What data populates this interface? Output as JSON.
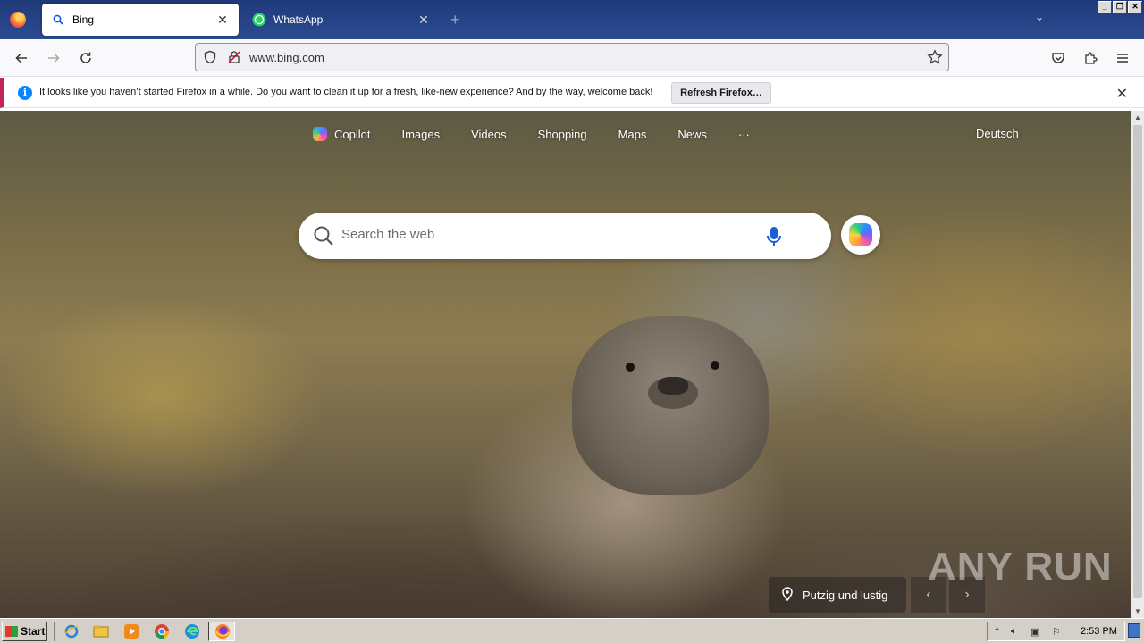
{
  "browser": {
    "tabs": [
      {
        "title": "Bing",
        "active": true,
        "icon": "search-icon"
      },
      {
        "title": "WhatsApp",
        "active": false,
        "icon": "whatsapp-icon"
      }
    ],
    "new_tab_glyph": "+",
    "url": "www.bing.com"
  },
  "notification": {
    "text": "It looks like you haven’t started Firefox in a while. Do you want to clean it up for a fresh, like-new experience? And by the way, welcome back!",
    "button": "Refresh Firefox…"
  },
  "bing": {
    "nav": [
      "Copilot",
      "Images",
      "Videos",
      "Shopping",
      "Maps",
      "News"
    ],
    "more": "···",
    "language": "Deutsch",
    "search_placeholder": "Search the web",
    "caption": "Putzig und lustig"
  },
  "watermark": "ANY RUN",
  "taskbar": {
    "start": "Start",
    "time": "2:53 PM"
  },
  "colors": {
    "tabbar": "#1f3a7a",
    "notice_accent": "#c3245f",
    "info_blue": "#0a84ff"
  }
}
